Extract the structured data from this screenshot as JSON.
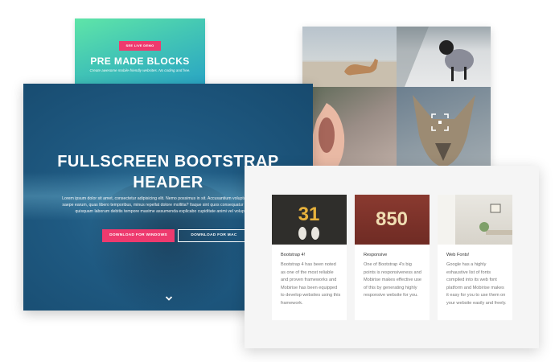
{
  "premade": {
    "demo_label": "SEE LIVE DEMO",
    "title": "PRE MADE BLOCKS",
    "subtitle": "Create awesome mobile-friendly websites. No coding and free."
  },
  "hero": {
    "title_line1": "FULLSCREEN BOOTSTRAP",
    "title_line2": "HEADER",
    "paragraph": "Lorem ipsum dolor sit amet, consectetur adipisicing elit. Nemo possimus in sit. Accusantium voluptas quas corporis saepe earum, quas libero temporibus, minus repellat dolore mollitia? Itaque sint quos consequatur culpa fugiat non quisquam laborum debitis tempore maxime assumenda explicabo cupiditate animi vel voluptas esse!",
    "btn_windows": "DOWNLOAD FOR WINDOWS",
    "btn_mac": "DOWNLOAD FOR MAC"
  },
  "features": [
    {
      "image_text": "31",
      "title": "Bootstrap 4!",
      "text": "Bootstrap 4 has been noted as one of the most reliable and proven frameworks and Mobirise has been equipped to develop websites using this framework."
    },
    {
      "image_text": "850",
      "title": "Responsive",
      "text": "One of Bootstrap 4's big points is responsiveness and Mobirise makes effective use of this by generating highly responsive website for you."
    },
    {
      "image_text": "",
      "title": "Web Fonts!",
      "text": "Google has a highly exhaustive list of fonts compiled into its web font platform and Mobirise makes it easy for you to use them on your website easily and freely."
    }
  ],
  "colors": {
    "accent": "#ee3a6e",
    "hero_blue": "#1f5a82",
    "premade_green": "#5fe5a8"
  },
  "icons": {
    "scroll_down": "chevron-down-icon",
    "focus": "camera-focus-icon"
  }
}
